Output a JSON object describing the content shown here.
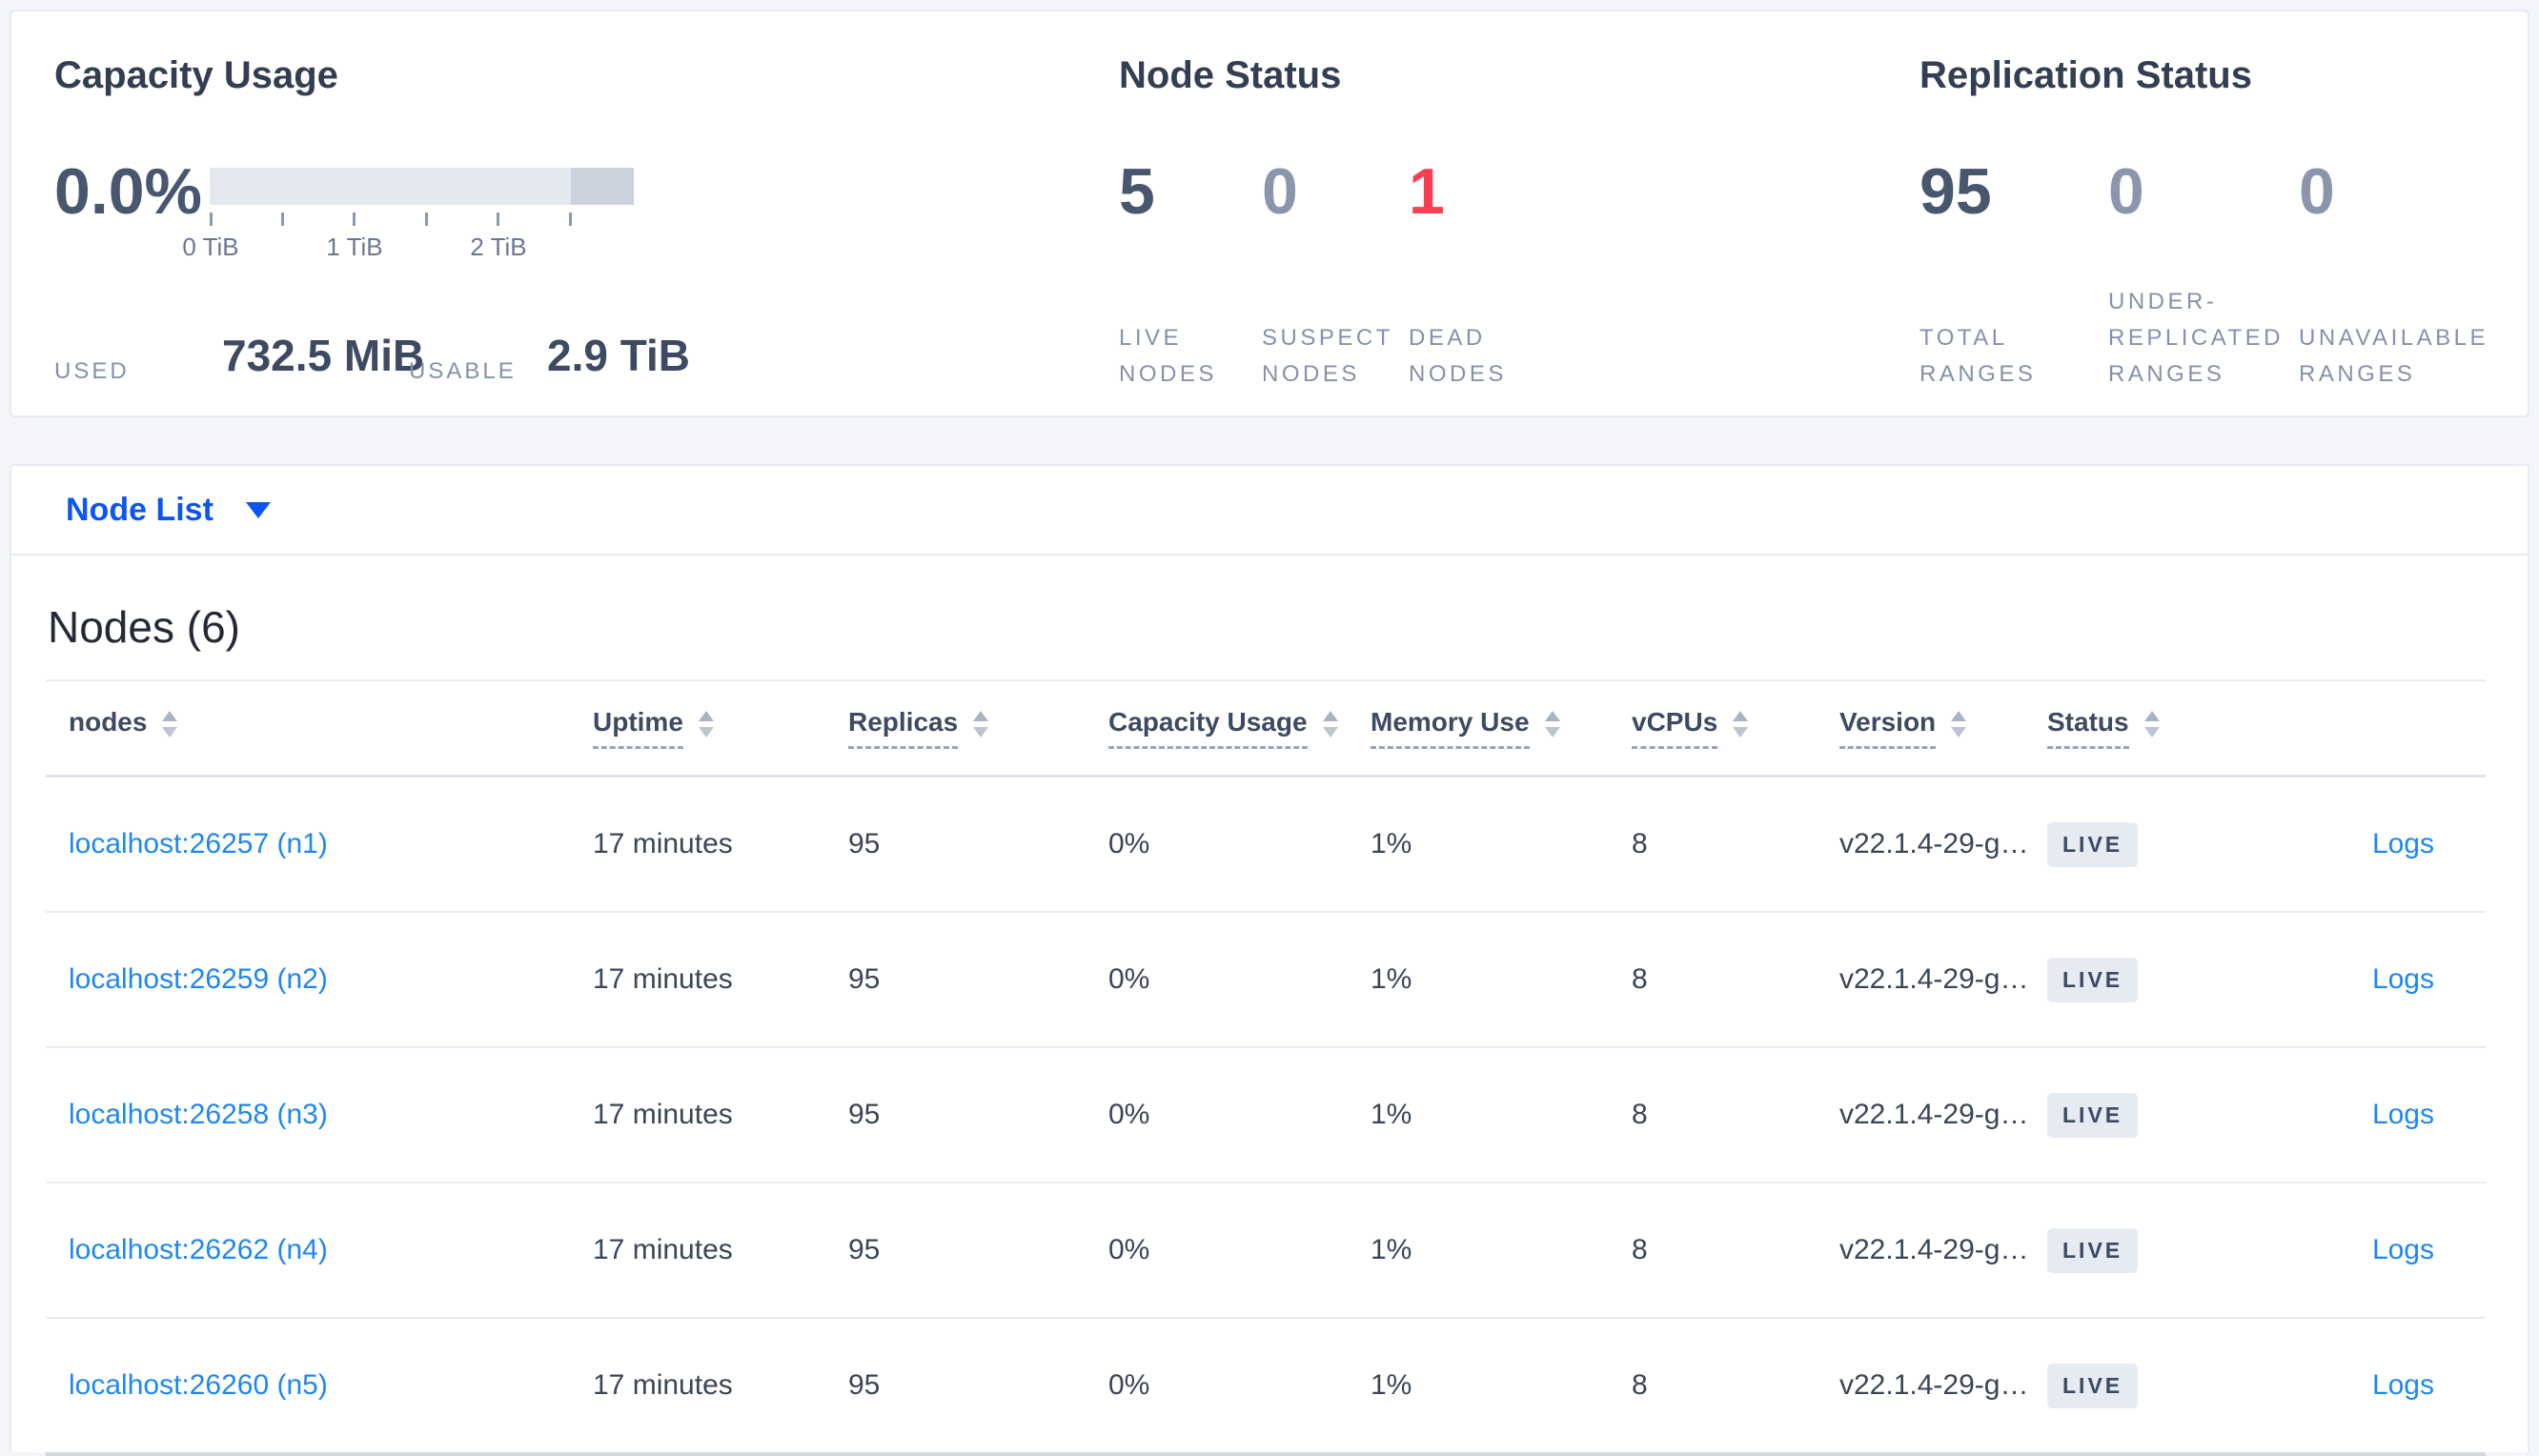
{
  "colors": {
    "page_bg": "#f3f5f9",
    "panel_border": "#e6eaf1",
    "accent_blue": "#0d55f0",
    "link_blue": "#1f87f0",
    "danger_red": "#fc3e53",
    "dark_number": "#48566e",
    "muted_number": "#8b96ad",
    "label_gray": "#8691a8",
    "badge_bg": "#e6eaf2",
    "bar_track": "#e4e8ef",
    "bar_tail": "#ccd2dd"
  },
  "summary": {
    "capacity": {
      "title": "Capacity Usage",
      "percent": "0.0%",
      "axis_ticks": [
        "0 TiB",
        "1 TiB",
        "2 TiB"
      ],
      "used_label": "USED",
      "used_value": "732.5 MiB",
      "usable_label": "USABLE",
      "usable_value": "2.9 TiB"
    },
    "node_status": {
      "title": "Node Status",
      "stats": [
        {
          "value": "5",
          "label": "LIVE\nNODES"
        },
        {
          "value": "0",
          "label": "SUSPECT\nNODES"
        },
        {
          "value": "1",
          "label": "DEAD\nNODES"
        }
      ]
    },
    "replication": {
      "title": "Replication Status",
      "stats": [
        {
          "value": "95",
          "label": "TOTAL\nRANGES"
        },
        {
          "value": "0",
          "label": "UNDER-\nREPLICATED\nRANGES"
        },
        {
          "value": "0",
          "label": "UNAVAILABLE\nRANGES"
        }
      ]
    }
  },
  "view_selector": {
    "label": "Node List"
  },
  "table": {
    "heading": "Nodes (6)",
    "logs_label": "Logs",
    "columns": [
      {
        "label": "nodes"
      },
      {
        "label": "Uptime"
      },
      {
        "label": "Replicas"
      },
      {
        "label": "Capacity Usage"
      },
      {
        "label": "Memory Use"
      },
      {
        "label": "vCPUs"
      },
      {
        "label": "Version"
      },
      {
        "label": "Status"
      }
    ],
    "rows": [
      {
        "node": "localhost:26257 (n1)",
        "uptime": "17 minutes",
        "replicas": "95",
        "capacity_usage": "0%",
        "memory_use": "1%",
        "vcpus": "8",
        "version": "v22.1.4-29-g…",
        "status": "LIVE"
      },
      {
        "node": "localhost:26259 (n2)",
        "uptime": "17 minutes",
        "replicas": "95",
        "capacity_usage": "0%",
        "memory_use": "1%",
        "vcpus": "8",
        "version": "v22.1.4-29-g…",
        "status": "LIVE"
      },
      {
        "node": "localhost:26258 (n3)",
        "uptime": "17 minutes",
        "replicas": "95",
        "capacity_usage": "0%",
        "memory_use": "1%",
        "vcpus": "8",
        "version": "v22.1.4-29-g…",
        "status": "LIVE"
      },
      {
        "node": "localhost:26262 (n4)",
        "uptime": "17 minutes",
        "replicas": "95",
        "capacity_usage": "0%",
        "memory_use": "1%",
        "vcpus": "8",
        "version": "v22.1.4-29-g…",
        "status": "LIVE"
      },
      {
        "node": "localhost:26260 (n5)",
        "uptime": "17 minutes",
        "replicas": "95",
        "capacity_usage": "0%",
        "memory_use": "1%",
        "vcpus": "8",
        "version": "v22.1.4-29-g…",
        "status": "LIVE"
      }
    ]
  }
}
